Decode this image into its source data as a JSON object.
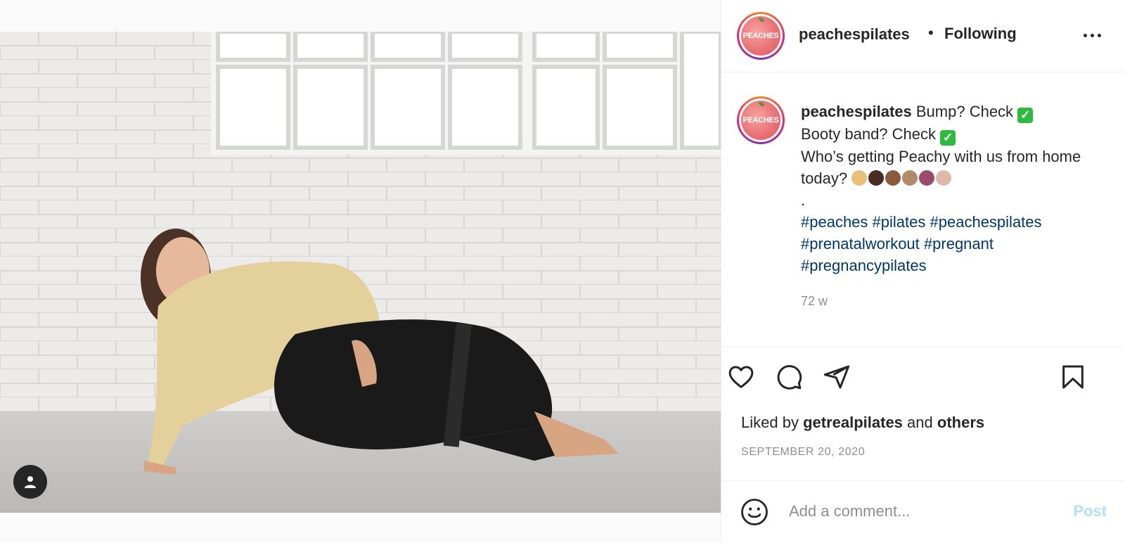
{
  "post": {
    "username": "peachespilates",
    "follow_status": "Following",
    "avatar_text": "PEACHES",
    "caption": {
      "username": "peachespilates",
      "line1": "Bump? Check",
      "line2": "Booty band? Check",
      "line3": "Who’s getting Peachy with us from home today?",
      "separator": ".",
      "hashtags_row1": [
        "#peaches",
        "#pilates",
        "#peachespilates"
      ],
      "hashtags_row2": [
        "#prenatalworkout",
        "#pregnant"
      ],
      "hashtags_row3": [
        "#pregnancypilates"
      ]
    },
    "time_ago": "72 w",
    "liked_by_prefix": "Liked by",
    "liked_by_user": "getrealpilates",
    "liked_by_and": "and",
    "liked_by_others": "others",
    "date": "SEPTEMBER 20, 2020",
    "band_text": "PEACHES"
  },
  "comment": {
    "placeholder": "Add a comment...",
    "post_label": "Post"
  },
  "colors": {
    "link": "#00376b",
    "post_disabled": "#b2dffc",
    "muted": "#8e8e8e"
  },
  "icons": [
    "heart-icon",
    "comment-icon",
    "share-icon",
    "bookmark-icon",
    "emoji-icon",
    "user-tag-icon",
    "more-icon"
  ]
}
